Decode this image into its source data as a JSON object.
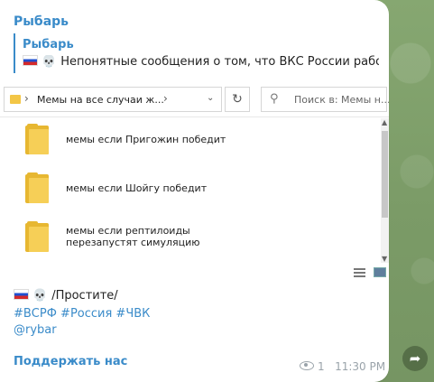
{
  "channel": {
    "name": "Рыбарь"
  },
  "reply": {
    "author": "Рыбарь",
    "text": "Непонятные сообщения о том, что ВКС России работа..."
  },
  "explorer": {
    "breadcrumb": "Мемы на все случаи ж...",
    "search_placeholder": "Поиск в: Мемы н...",
    "items": [
      {
        "label": "мемы если Пригожин победит"
      },
      {
        "label": "мемы если Шойгу победит"
      },
      {
        "label": "мемы если рептилоиды перезапустят симуляцию"
      }
    ]
  },
  "post": {
    "caption": "/Простите/",
    "hashtags": "#ВСРФ #Россия #ЧВК",
    "handle": "@rybar",
    "support_link": "Поддержать нас",
    "views": "1",
    "time": "11:30 PM"
  },
  "icons": {
    "flag": "russia-flag-icon",
    "skull": "skull-icon",
    "share": "share-icon",
    "views": "eye-icon"
  },
  "colors": {
    "accent": "#3a8bc9",
    "folder": "#f3c646",
    "background": "#7f9f6d"
  }
}
